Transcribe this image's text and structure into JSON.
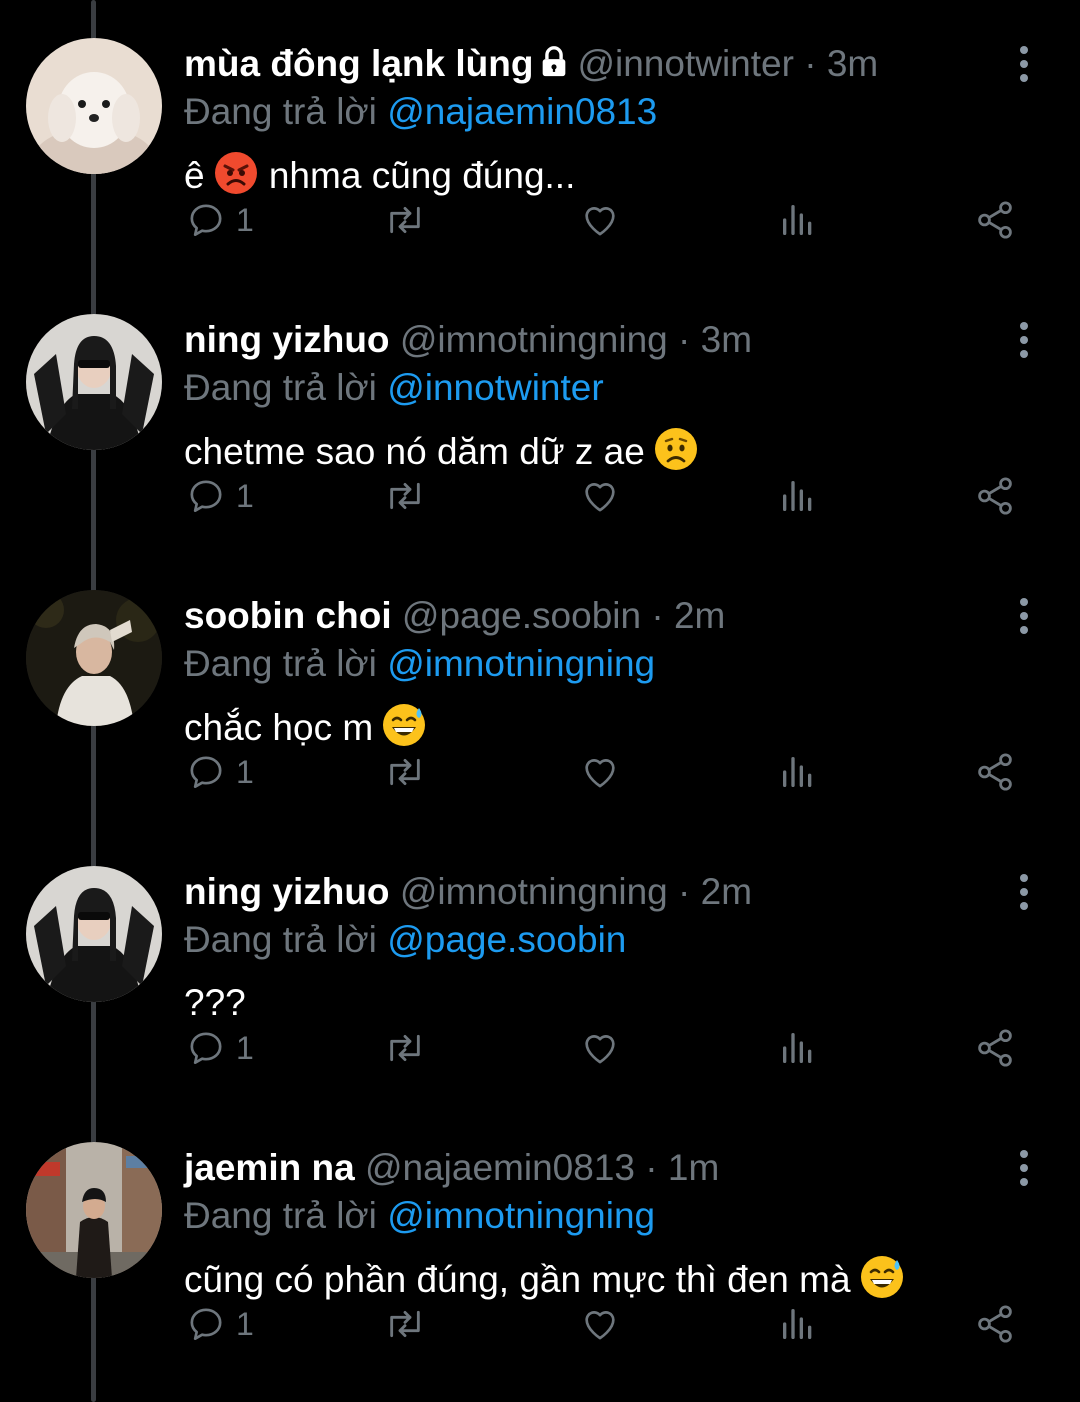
{
  "reply_prefix": "Đang trả lời",
  "colors": {
    "background": "#000000",
    "text": "#ffffff",
    "muted": "#6e767d",
    "link": "#1d9bf0",
    "thread_line": "#3a3d41"
  },
  "tweets": [
    {
      "name": "mùa đông lạnk lùng",
      "protected": true,
      "handle": "@innotwinter",
      "dot": "·",
      "time": "3m",
      "reply_to": "@najaemin0813",
      "text": "ê",
      "text_after_emoji": "nhma cũng đúng...",
      "emoji": "angry-face-icon",
      "replies": "1",
      "avatar": "white-puppy-avatar"
    },
    {
      "name": "ning yizhuo",
      "handle": "@imnotningning",
      "dot": "·",
      "time": "3m",
      "reply_to": "@innotwinter",
      "text": "chetme sao nó dăm dữ z ae",
      "emoji": "worried-face-icon",
      "replies": "1",
      "avatar": "girl-sunglasses-avatar"
    },
    {
      "name": "soobin choi",
      "handle": "@page.soobin",
      "dot": "·",
      "time": "2m",
      "reply_to": "@imnotningning",
      "text": "chắc học m",
      "emoji": "grinning-sweat-face-icon",
      "replies": "1",
      "avatar": "boy-night-avatar"
    },
    {
      "name": "ning yizhuo",
      "handle": "@imnotningning",
      "dot": "·",
      "time": "2m",
      "reply_to": "@page.soobin",
      "text": "???",
      "replies": "1",
      "avatar": "girl-sunglasses-avatar"
    },
    {
      "name": "jaemin na",
      "handle": "@najaemin0813",
      "dot": "·",
      "time": "1m",
      "reply_to": "@imnotningning",
      "text": "cũng có phần đúng, gần mực thì đen mà",
      "emoji": "grinning-sweat-face-icon",
      "replies": "1",
      "avatar": "street-photo-avatar"
    }
  ]
}
